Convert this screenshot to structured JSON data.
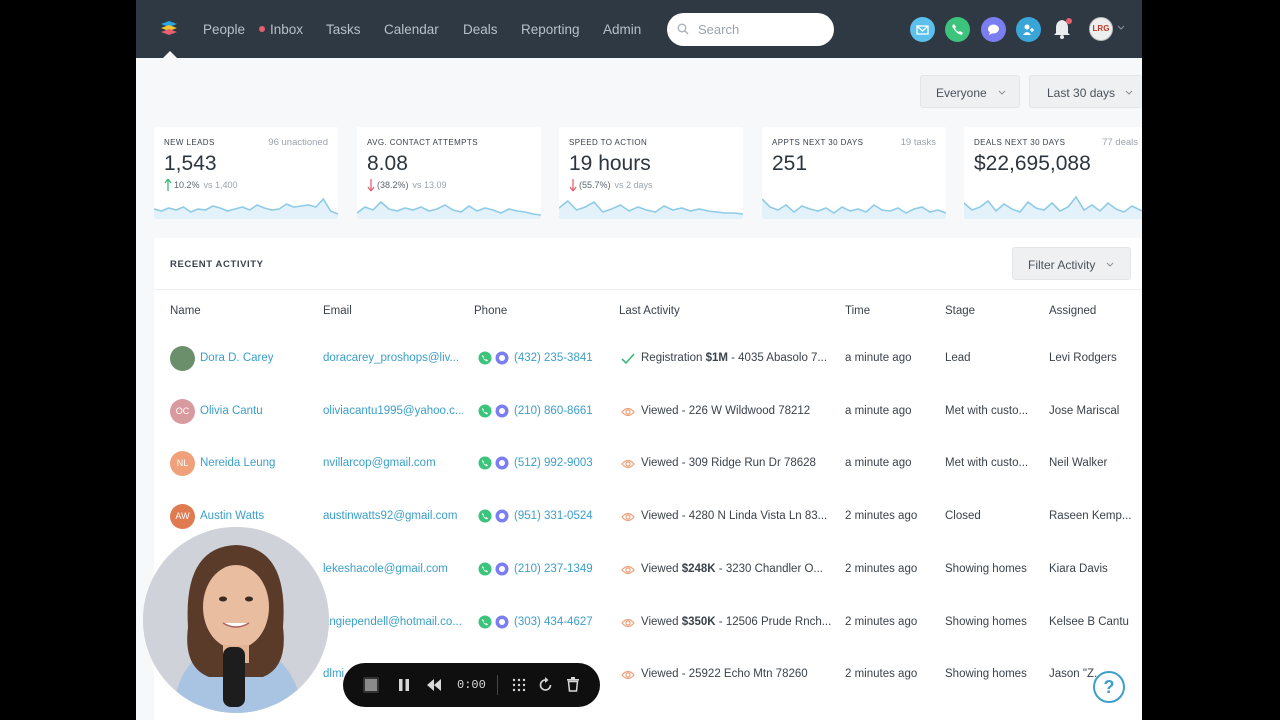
{
  "nav": {
    "items": [
      "People",
      "Inbox",
      "Tasks",
      "Calendar",
      "Deals",
      "Reporting",
      "Admin"
    ],
    "search_placeholder": "Search",
    "user_initials": "LRG"
  },
  "filters": {
    "audience": "Everyone",
    "range": "Last 30 days"
  },
  "cards": [
    {
      "title": "NEW LEADS",
      "sub": "96 unactioned",
      "value": "1,543",
      "delta": "10.2%",
      "vs": "vs 1,400",
      "trend": "up"
    },
    {
      "title": "AVG. CONTACT ATTEMPTS",
      "sub": "",
      "value": "8.08",
      "delta": "(38.2%)",
      "vs": "vs 13.09",
      "trend": "down"
    },
    {
      "title": "SPEED TO ACTION",
      "sub": "",
      "value": "19 hours",
      "delta": "(55.7%)",
      "vs": "vs 2 days",
      "trend": "down"
    },
    {
      "title": "APPTS NEXT 30 DAYS",
      "sub": "19 tasks",
      "value": "251",
      "delta": "",
      "vs": "",
      "trend": "none"
    },
    {
      "title": "DEALS NEXT 30 DAYS",
      "sub": "77 deals",
      "value": "$22,695,088",
      "delta": "",
      "vs": "",
      "trend": "none"
    }
  ],
  "activity": {
    "title": "RECENT ACTIVITY",
    "filter_label": "Filter Activity",
    "columns": [
      "Name",
      "Email",
      "Phone",
      "Last Activity",
      "Time",
      "Stage",
      "Assigned"
    ],
    "rows": [
      {
        "initials": "",
        "color": "#6b8f6b",
        "name": "Dora D. Carey",
        "email": "doracarey_proshops@liv...",
        "phone": "(432) 235-3841",
        "activity_icon": "check-icon",
        "activity_pre": "Registration ",
        "activity_bold": "$1M",
        "activity_post": " - 4035 Abasolo 7...",
        "time": "a minute ago",
        "stage": "Lead",
        "assigned": "Levi Rodgers"
      },
      {
        "initials": "OC",
        "color": "#d99a9f",
        "name": "Olivia Cantu",
        "email": "oliviacantu1995@yahoo.c...",
        "phone": "(210) 860-8661",
        "activity_icon": "eye-icon",
        "activity_pre": "Viewed - 226 W Wildwood 78212",
        "activity_bold": "",
        "activity_post": "",
        "time": "a minute ago",
        "stage": "Met with custo...",
        "assigned": "Jose Mariscal"
      },
      {
        "initials": "NL",
        "color": "#f0a07a",
        "name": "Nereida Leung",
        "email": "nvillarcop@gmail.com",
        "phone": "(512) 992-9003",
        "activity_icon": "eye-icon",
        "activity_pre": "Viewed - 309 Ridge Run Dr 78628",
        "activity_bold": "",
        "activity_post": "",
        "time": "a minute ago",
        "stage": "Met with custo...",
        "assigned": "Neil Walker"
      },
      {
        "initials": "AW",
        "color": "#e07a50",
        "name": "Austin Watts",
        "email": "austinwatts92@gmail.com",
        "phone": "(951) 331-0524",
        "activity_icon": "eye-icon",
        "activity_pre": "Viewed - 4280 N Linda Vista Ln 83...",
        "activity_bold": "",
        "activity_post": "",
        "time": "2 minutes ago",
        "stage": "Closed",
        "assigned": "Raseen Kemp..."
      },
      {
        "initials": "",
        "color": "#9ab",
        "name": "",
        "email": "lekeshacole@gmail.com",
        "phone": "(210) 237-1349",
        "activity_icon": "eye-icon",
        "activity_pre": "Viewed ",
        "activity_bold": "$248K",
        "activity_post": " - 3230 Chandler O...",
        "time": "2 minutes ago",
        "stage": "Showing homes",
        "assigned": "Kiara Davis"
      },
      {
        "initials": "",
        "color": "#9ab",
        "name": "",
        "email": "angiependell@hotmail.co...",
        "phone": "(303) 434-4627",
        "activity_icon": "eye-icon",
        "activity_pre": "Viewed ",
        "activity_bold": "$350K",
        "activity_post": " - 12506 Prude Rnch...",
        "time": "2 minutes ago",
        "stage": "Showing homes",
        "assigned": "Kelsee B Cantu"
      },
      {
        "initials": "",
        "color": "#9ab",
        "name": "",
        "email": "dlmi...",
        "phone": "",
        "activity_icon": "eye-icon",
        "activity_pre": "Viewed - 25922 Echo Mtn 78260",
        "activity_bold": "",
        "activity_post": "",
        "time": "2 minutes ago",
        "stage": "Showing homes",
        "assigned": "Jason \"Z..."
      }
    ]
  },
  "recorder": {
    "time": "0:00"
  },
  "help_label": "?",
  "colors": {
    "nav_bg": "#2f3943",
    "link": "#3b9fc9",
    "spark": "#8fcbe6",
    "up": "#3cb878",
    "down": "#e8606e"
  }
}
